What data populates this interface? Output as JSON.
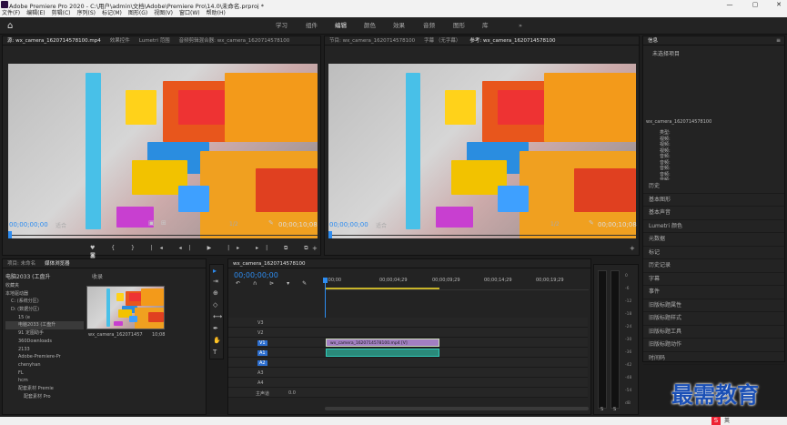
{
  "titlebar": {
    "title": "Adobe Premiere Pro 2020 - C:\\用户\\admin\\文档\\Adobe\\Premiere Pro\\14.0\\未命名.prproj *",
    "min": "—",
    "max": "▢",
    "close": "✕"
  },
  "menu": [
    "文件(F)",
    "编辑(E)",
    "剪辑(C)",
    "序列(S)",
    "标记(M)",
    "图形(G)",
    "视图(V)",
    "窗口(W)",
    "帮助(H)"
  ],
  "workspaces": {
    "home": "⌂",
    "tabs": [
      "学习",
      "组件",
      "编辑",
      "颜色",
      "效果",
      "音频",
      "图形",
      "库"
    ],
    "more": "»"
  },
  "source": {
    "tabs": [
      "源: wx_camera_1620714578100.mp4",
      "效果控件",
      "Lumetri 范围",
      "音频剪辑混合器: wx_camera_1620714578100"
    ],
    "timecode": "00;00;00;00",
    "fit": "适合",
    "res": "1/2",
    "duration": "00;00;10;08"
  },
  "program": {
    "tabs": [
      "节目: wx_camera_1620714578100",
      "字幕 （无字幕）",
      "参考: wx_camera_1620714578100"
    ],
    "timecode": "00;00;00;00",
    "fit": "适合",
    "res": "1/2",
    "duration": "00;00;10;08"
  },
  "info": {
    "tab": "信息",
    "menu": "≡",
    "unselected": "未选择项目",
    "clipname": "wx_camera_1620714578100",
    "rows": [
      "类型:",
      "视频:",
      "视频:",
      "视频:",
      "音频:",
      "音频:",
      "音频:",
      "音频:",
      "音频:"
    ],
    "menu_items": [
      "历史",
      "基本图形",
      "基本声音",
      "Lumetri 颜色",
      "元数据",
      "标记",
      "历史记录",
      "字幕",
      "事件",
      "旧版标题属性",
      "旧版标题样式",
      "旧版标题工具",
      "旧版标题动作",
      "时间码"
    ]
  },
  "project": {
    "tabs": [
      "项目: 未命名",
      "媒体浏览器"
    ],
    "path": "电脑2033 (工盘升",
    "search_ph": "收录",
    "tree": [
      "收藏夹",
      "本地驱动器",
      "C: (系统分区)",
      "D: (数据分区)",
      "15 (e",
      "电脑2033 (工盘升",
      "91 定图助手",
      "360Downloads",
      "2133",
      "Adobe-Premiere-Pr",
      "chenyhan",
      "FL",
      "hcm",
      "配套素材 Premie",
      "配套素材 Pro"
    ],
    "thumb_name": "wx_camera_1620714578100.mp4",
    "thumb_dur": "10;08"
  },
  "timeline": {
    "tab": "wx_camera_1620714578100",
    "timecode": "00;00;00;00",
    "ruler": [
      ":00;00",
      "00;00;04;29",
      "00;00;09;29",
      "00;00;14;29",
      "00;00;19;29"
    ],
    "vtracks": [
      "V3",
      "V2",
      "V1"
    ],
    "atracks": [
      "A1",
      "A2",
      "A3",
      "A4"
    ],
    "master": "主声道",
    "master_val": "0.0",
    "clip_label": "wx_camera_1620714578100.mp4 [V]"
  },
  "meter": {
    "scale": [
      "0",
      "-6",
      "-12",
      "-18",
      "-24",
      "-30",
      "-36",
      "-42",
      "-48",
      "-54",
      "dB"
    ],
    "labels": [
      "S",
      "S"
    ]
  },
  "watermark": "最需教育",
  "taskbar": {
    "ime": "英"
  }
}
